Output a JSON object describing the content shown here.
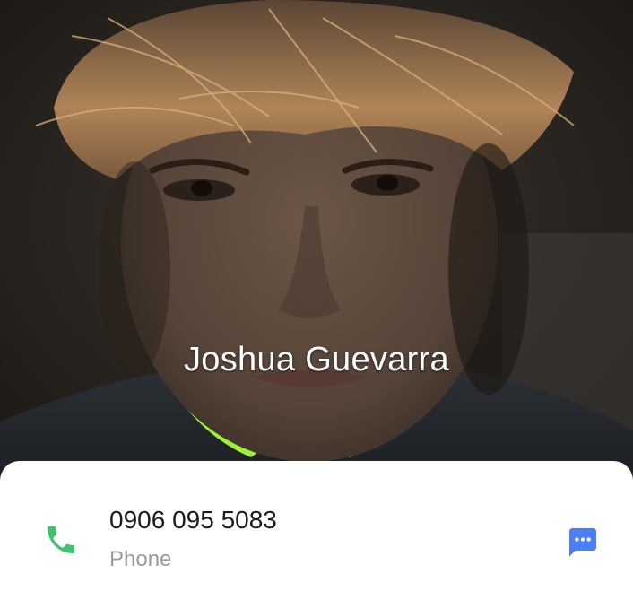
{
  "contact": {
    "name": "Joshua Guevarra"
  },
  "phone_entry": {
    "number": "0906 095 5083",
    "type_label": "Phone"
  },
  "icons": {
    "call": "phone-icon",
    "message": "message-icon"
  },
  "colors": {
    "call_icon": "#3ec46d",
    "message_icon": "#4c7ef5",
    "card_background": "#ffffff"
  }
}
